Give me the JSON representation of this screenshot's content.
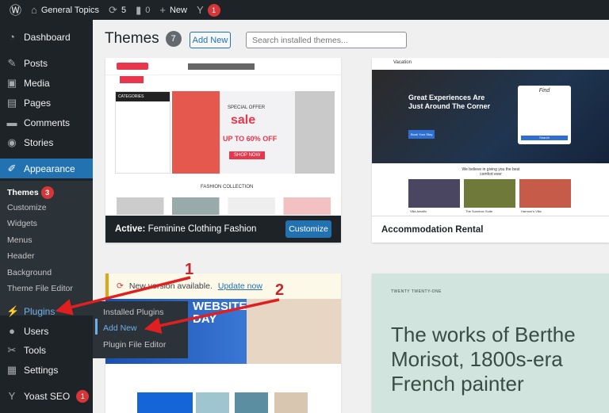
{
  "adminbar": {
    "site": "General Topics",
    "updates": "5",
    "comments": "0",
    "new": "New",
    "yoast_count": "1"
  },
  "sidebar": {
    "items": [
      {
        "label": "Dashboard",
        "icon": "dashboard-icon"
      },
      {
        "label": "Posts",
        "icon": "pin-icon"
      },
      {
        "label": "Media",
        "icon": "media-icon"
      },
      {
        "label": "Pages",
        "icon": "pages-icon"
      },
      {
        "label": "Comments",
        "icon": "comment-icon"
      },
      {
        "label": "Stories",
        "icon": "stories-icon"
      },
      {
        "label": "Appearance",
        "icon": "brush-icon"
      },
      {
        "label": "Plugins",
        "icon": "plug-icon"
      },
      {
        "label": "Users",
        "icon": "user-icon"
      },
      {
        "label": "Tools",
        "icon": "wrench-icon"
      },
      {
        "label": "Settings",
        "icon": "settings-icon"
      },
      {
        "label": "Yoast SEO",
        "icon": "yoast-icon",
        "badge": "1"
      }
    ],
    "appearance_sub": [
      {
        "label": "Themes",
        "badge": "3"
      },
      {
        "label": "Customize"
      },
      {
        "label": "Widgets"
      },
      {
        "label": "Menus"
      },
      {
        "label": "Header"
      },
      {
        "label": "Background"
      },
      {
        "label": "Theme File Editor"
      }
    ],
    "plugins_flyout": [
      "Installed Plugins",
      "Add New",
      "Plugin File Editor"
    ]
  },
  "main": {
    "title": "Themes",
    "count": "7",
    "add_new": "Add New",
    "search_placeholder": "Search installed themes...",
    "themes": [
      {
        "active_label": "Active:",
        "name": "Feminine Clothing Fashion",
        "customize": "Customize",
        "preview": {
          "sale_top": "SPECIAL OFFER",
          "sale": "sale",
          "discount": "UP TO 60% OFF",
          "shop": "SHOP NOW",
          "categories": "CATEGORIES",
          "collection": "FASHION COLLECTION"
        }
      },
      {
        "name": "Accommodation Rental",
        "preview": {
          "brand": "Vacation",
          "headline": "Great Experiences Are Just Around The Corner",
          "button": "Book Your Stay",
          "form_title": "Find",
          "form_button": "Search",
          "tagline": "We believe in giving you the best comfort ever",
          "listings": [
            "Villa Amalfo",
            "The Sunnbox Suite",
            "Harmon's Villa"
          ]
        }
      },
      {
        "notice": "New version available.",
        "update_link": "Update now",
        "preview": {
          "headline": "WEBSITE DAY"
        }
      },
      {
        "preview": {
          "nav": "TWENTY TWENTY-ONE",
          "headline": "The works of Berthe Morisot, 1800s-era French painter"
        }
      }
    ]
  },
  "annotations": {
    "arrow1": "1",
    "arrow2": "2",
    "color": "#e02020"
  }
}
